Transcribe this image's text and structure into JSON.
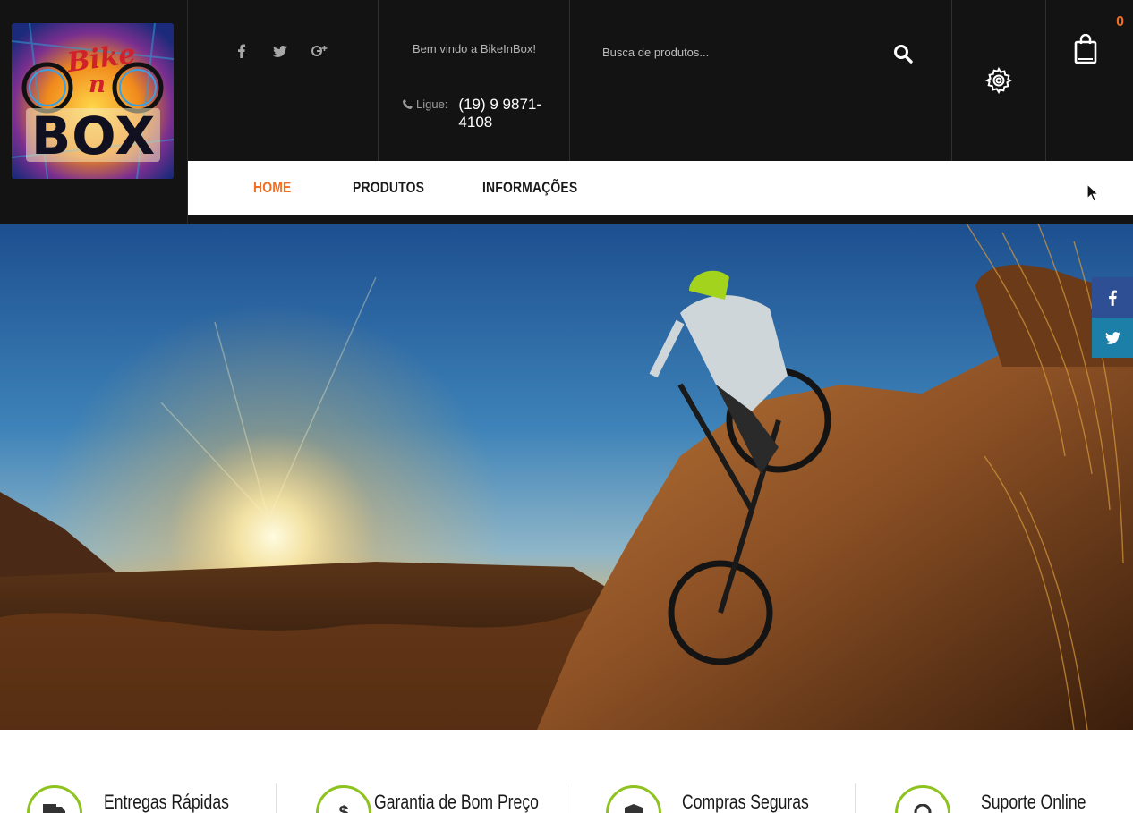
{
  "header": {
    "logo_alt": "Bike n BOX",
    "logo_text_top": "Bike",
    "logo_text_mid": "n",
    "logo_text_bottom": "BOX",
    "social": [
      "facebook-icon",
      "twitter-icon",
      "google-plus-icon"
    ],
    "welcome": "Bem vindo a BikeInBox!",
    "phone_label": "Ligue:",
    "phone_number": "(19) 9 9871-4108",
    "search_placeholder": "Busca de produtos...",
    "cart_count": "0"
  },
  "nav": {
    "items": [
      "HOME",
      "PRODUTOS",
      "INFORMAÇÕES"
    ],
    "active": "HOME"
  },
  "share": [
    "facebook-icon",
    "twitter-icon"
  ],
  "features": {
    "items": [
      "Entregas Rápidas",
      "Garantia de Bom Preço",
      "Compras Seguras",
      "Suporte Online"
    ]
  },
  "colors": {
    "accent": "#f26f21",
    "header_bg": "#131313",
    "feature_ring": "#8dc21f",
    "facebook": "#2f4f95",
    "twitter": "#1b7fa8"
  }
}
